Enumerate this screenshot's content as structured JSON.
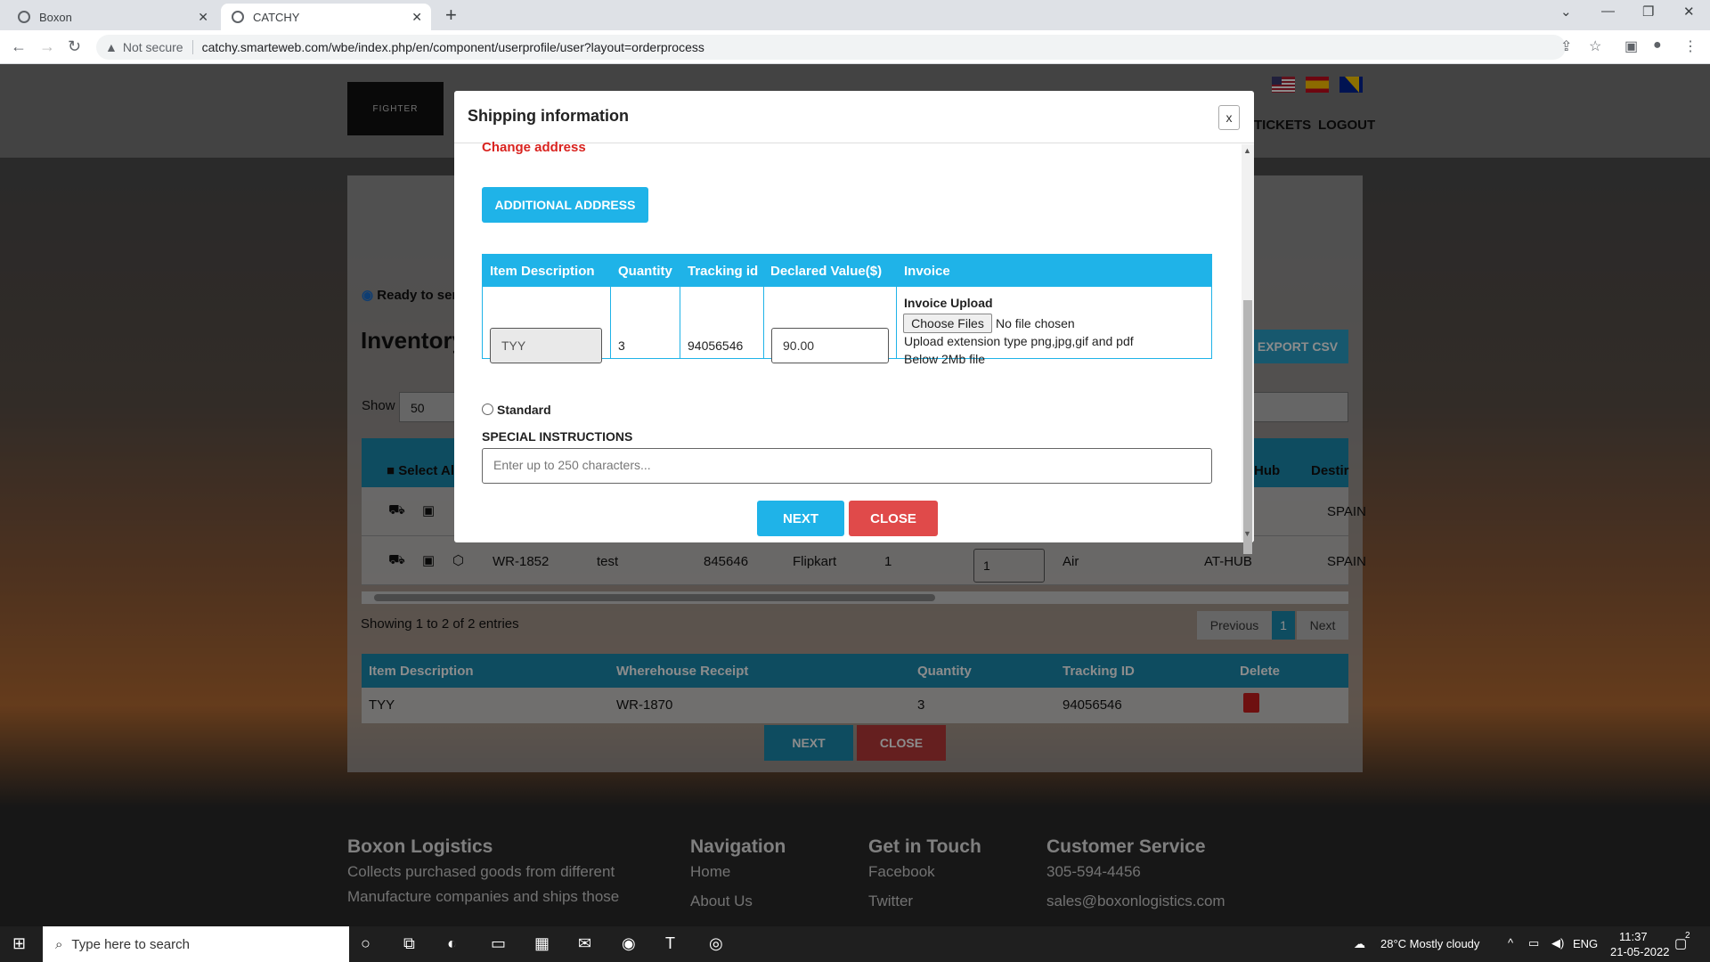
{
  "browser": {
    "tabs": [
      {
        "label": "Boxon"
      },
      {
        "label": "CATCHY"
      }
    ],
    "not_secure": "Not secure",
    "url": "catchy.smarteweb.com/wbe/index.php/en/component/userprofile/user?layout=orderprocess"
  },
  "site": {
    "logo_text": "FIGHTER",
    "nav": [
      "TICKETS",
      "LOGOUT"
    ],
    "ready_label": "Ready to sen",
    "inventory_title": "Inventory",
    "export_label": "EXPORT CSV",
    "show_label": "Show",
    "show_value": "50",
    "table_headers": {
      "select_all": "Select Al",
      "hub": "Hub",
      "destination": "Destir"
    },
    "row1": {
      "destination": "SPAIN"
    },
    "row2": {
      "receipt": "WR-1852",
      "desc": "test",
      "tracking": "845646",
      "store": "Flipkart",
      "qty": "1",
      "input": "1",
      "mode": "Air",
      "hub": "AT-HUB",
      "destination": "SPAIN"
    },
    "showing": "Showing 1 to 2 of 2 entries",
    "pager": {
      "prev": "Previous",
      "page": "1",
      "next": "Next"
    },
    "cart_headers": [
      "Item Description",
      "Wherehouse Receipt",
      "Quantity",
      "Tracking ID",
      "Delete"
    ],
    "cart_row": [
      "TYY",
      "WR-1870",
      "3",
      "94056546"
    ],
    "next_label": "NEXT",
    "close_label": "CLOSE"
  },
  "footer": {
    "company": "Boxon Logistics",
    "company_text_1": "Collects purchased goods from different",
    "company_text_2": "Manufacture companies and ships those",
    "navigation": "Navigation",
    "nav_links": [
      "Home",
      "About Us"
    ],
    "get_in_touch": "Get in Touch",
    "social": [
      "Facebook",
      "Twitter"
    ],
    "customer_service": "Customer Service",
    "phone": "305-594-4456",
    "email": "sales@boxonlogistics.com"
  },
  "modal": {
    "title": "Shipping information",
    "close_x": "x",
    "change_address": "Change address",
    "additional_address": "ADDITIONAL ADDRESS",
    "headers": [
      "Item Description",
      "Quantity",
      "Tracking id",
      "Declared Value($)",
      "Invoice"
    ],
    "row": {
      "description": "TYY",
      "quantity": "3",
      "tracking": "94056546",
      "declared_value": "90.00",
      "invoice_upload": "Invoice Upload",
      "choose_files": "Choose Files",
      "no_file": "No file chosen",
      "upload_hint": "Upload extension type png,jpg,gif and pdf",
      "size_hint": "Below 2Mb file"
    },
    "standard_label": "Standard",
    "special_instructions": "SPECIAL INSTRUCTIONS",
    "special_placeholder": "Enter up to 250 characters...",
    "next": "NEXT",
    "close": "CLOSE"
  },
  "taskbar": {
    "search_placeholder": "Type here to search",
    "weather": "28°C  Mostly cloudy",
    "lang": "ENG",
    "time": "11:37",
    "date": "21-05-2022",
    "notif_count": "2"
  },
  "colors": {
    "accent_blue": "#1fb3e8",
    "close_red": "#e04a4a",
    "change_address_red": "#d9231f"
  }
}
